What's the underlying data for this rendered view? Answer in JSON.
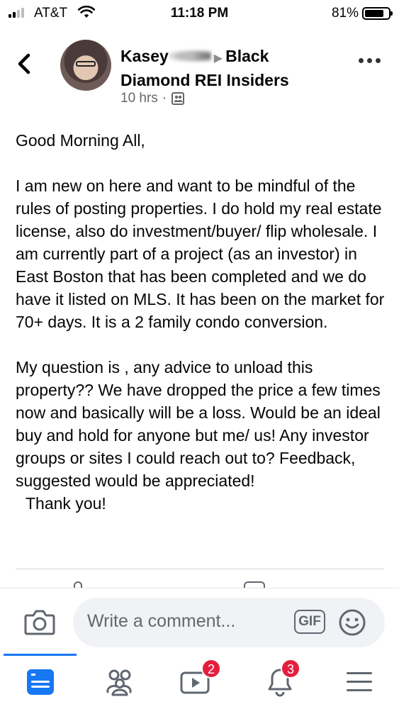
{
  "status_bar": {
    "carrier": "AT&T",
    "time": "11:18 PM",
    "battery": "81%",
    "battery_level": 0.81
  },
  "post": {
    "author_first": "Kasey",
    "group_name_line1": "Black",
    "group_name_line2": "Diamond REI Insiders",
    "time_ago": "10 hrs",
    "separator": "·",
    "audience_icon": "group-members-icon",
    "paragraphs": [
      "Good Morning All,",
      "I am new on here and want to be mindful of the rules of posting properties. I do hold my real estate license,  also do investment/buyer/ flip wholesale. I am currently part of a project (as an investor) in East Boston that has been completed and we do have it listed on MLS. It has been on the market for 70+ days. It is a 2 family condo conversion.",
      "My question is , any advice to unload this property??  We have dropped the price a few times now and basically will be a loss. Would be an ideal buy and hold for anyone but me/ us!  Any investor groups or sites I could reach out to? Feedback, suggested would be appreciated!"
    ],
    "closing": "Thank you!"
  },
  "comment_bar": {
    "placeholder": "Write a comment...",
    "gif_label": "GIF"
  },
  "tab_bar": {
    "tabs": [
      {
        "name": "news-feed",
        "icon": "news-feed-icon",
        "active": true
      },
      {
        "name": "groups",
        "icon": "groups-icon",
        "active": false
      },
      {
        "name": "watch",
        "icon": "watch-icon",
        "badge": "2"
      },
      {
        "name": "notifications",
        "icon": "bell-icon",
        "badge": "3"
      },
      {
        "name": "menu",
        "icon": "hamburger-menu-icon",
        "active": false
      }
    ]
  },
  "colors": {
    "accent": "#1877f2",
    "badge": "#e41e3f",
    "secondary_text": "#65676b"
  }
}
